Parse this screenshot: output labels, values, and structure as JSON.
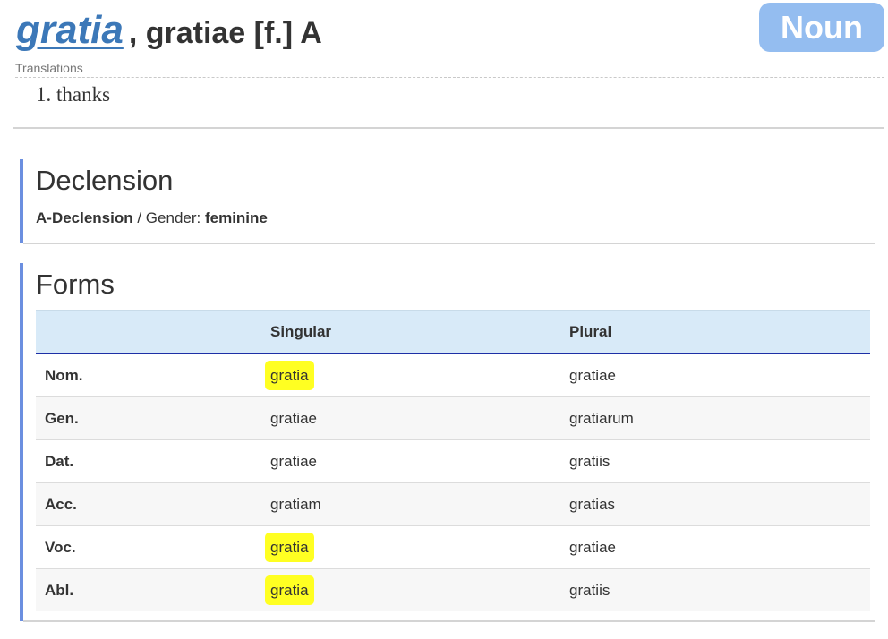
{
  "entry": {
    "headword": "gratia",
    "rest": ", gratiae [f.] A",
    "part_of_speech": "Noun"
  },
  "translations": {
    "label": "Translations",
    "items": [
      "1. thanks"
    ]
  },
  "declension": {
    "title": "Declension",
    "type": "A-Declension",
    "separator": " / Gender: ",
    "gender": "feminine"
  },
  "forms": {
    "title": "Forms",
    "headers": [
      "",
      "Singular",
      "Plural"
    ],
    "rows": [
      {
        "case": "Nom.",
        "singular": "gratia",
        "plural": "gratiae"
      },
      {
        "case": "Gen.",
        "singular": "gratiae",
        "plural": "gratiarum"
      },
      {
        "case": "Dat.",
        "singular": "gratiae",
        "plural": "gratiis"
      },
      {
        "case": "Acc.",
        "singular": "gratiam",
        "plural": "gratias"
      },
      {
        "case": "Voc.",
        "singular": "gratia",
        "plural": "gratiae"
      },
      {
        "case": "Abl.",
        "singular": "gratia",
        "plural": "gratiis"
      }
    ]
  },
  "colors": {
    "link": "#3c78b8",
    "badge": "#94bdf0",
    "section_accent": "#6b8fe0",
    "table_header": "#d8eaf8",
    "highlight": "#ffff22"
  }
}
